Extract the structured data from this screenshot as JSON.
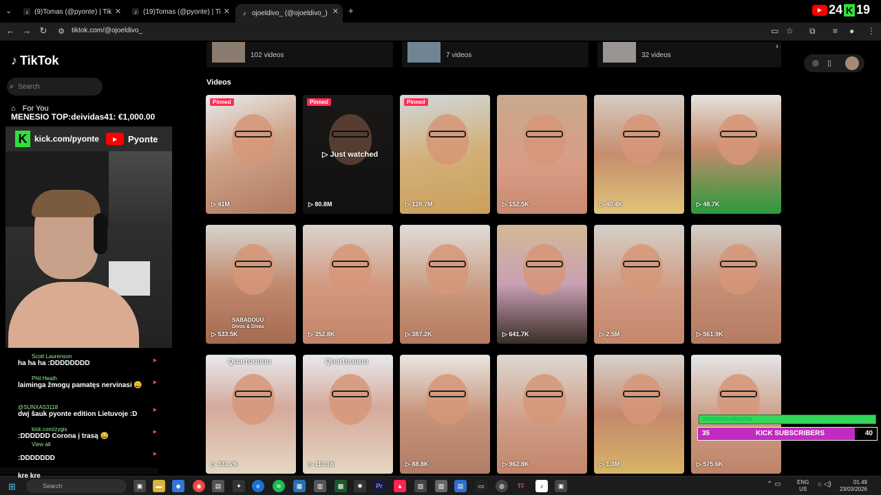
{
  "browser": {
    "tabs": [
      {
        "title": "(9)Tomas (@pyonte) | TikTok"
      },
      {
        "title": "(19)Tomas (@pyonte) | TikTok"
      },
      {
        "title": "ojoeldivo_ (@ojoeldivo_) | TikTok"
      }
    ],
    "new_tab": "+",
    "url": "tiktok.com/@ojoeldivo_"
  },
  "stream_logo": {
    "text": "24",
    "num": "19"
  },
  "sidebar": {
    "logo": "TikTok",
    "search_placeholder": "Search",
    "for_you": "For You"
  },
  "overlay": {
    "top_donor": "MENESIO TOP:deividas41: €1,000.00",
    "kick_link": "kick.com/pyonte",
    "youtube_name": "Pyonte"
  },
  "chat": [
    {
      "user": "Scott Laurenson",
      "msg": "ha ha ha :DDDDDDDD"
    },
    {
      "user": "Phil Heath",
      "msg": "laiminga žmogų pamatęs nervinasi 😄"
    },
    {
      "user": "@SUNXAS3118",
      "msg": "dwj šauk pyonte edition Lietuvoje :D"
    },
    {
      "user": "kick.com/zygis",
      "msg": ":DDDDDD Corona į trasą 😄"
    },
    {
      "user": "View all",
      "msg": ":DDDDDDD"
    }
  ],
  "taskbar_chat_line": "kre kre",
  "playlists": [
    {
      "count": "102 videos"
    },
    {
      "count": "7 videos"
    },
    {
      "count": "32 videos"
    }
  ],
  "videos_heading": "Videos",
  "pinned_label": "Pinned",
  "just_watched": "Just watched",
  "videos": [
    {
      "views": "41M",
      "pinned": true
    },
    {
      "views": "80.8M",
      "pinned": true,
      "watched": true
    },
    {
      "views": "128.7M",
      "pinned": true
    },
    {
      "views": "152.5K"
    },
    {
      "views": "40.4K"
    },
    {
      "views": "48.7K"
    },
    {
      "views": "533.5K",
      "caption": "SABADOUU",
      "caption2": "Divos & Divas"
    },
    {
      "views": "352.8K"
    },
    {
      "views": "387.2K"
    },
    {
      "views": "641.7K"
    },
    {
      "views": "2.5M"
    },
    {
      "views": "561.9K"
    },
    {
      "views": "331.7K",
      "caption": "Quartouuuu"
    },
    {
      "views": "110.1K",
      "caption": "Quartouuuu"
    },
    {
      "views": "88.8K"
    },
    {
      "views": "962.8K"
    },
    {
      "views": "1.3M"
    },
    {
      "views": "575.6K"
    }
  ],
  "subs": {
    "bar_label": "SUBATONO PRADŽIA!",
    "count": "35",
    "label": "KICK SUBSCRIBERS",
    "goal": "40",
    "progress": 0.875
  },
  "taskbar": {
    "search_placeholder": "Search",
    "lang1": "ENG",
    "lang2": "US",
    "time": "01.49",
    "date": "23/03/2026"
  }
}
